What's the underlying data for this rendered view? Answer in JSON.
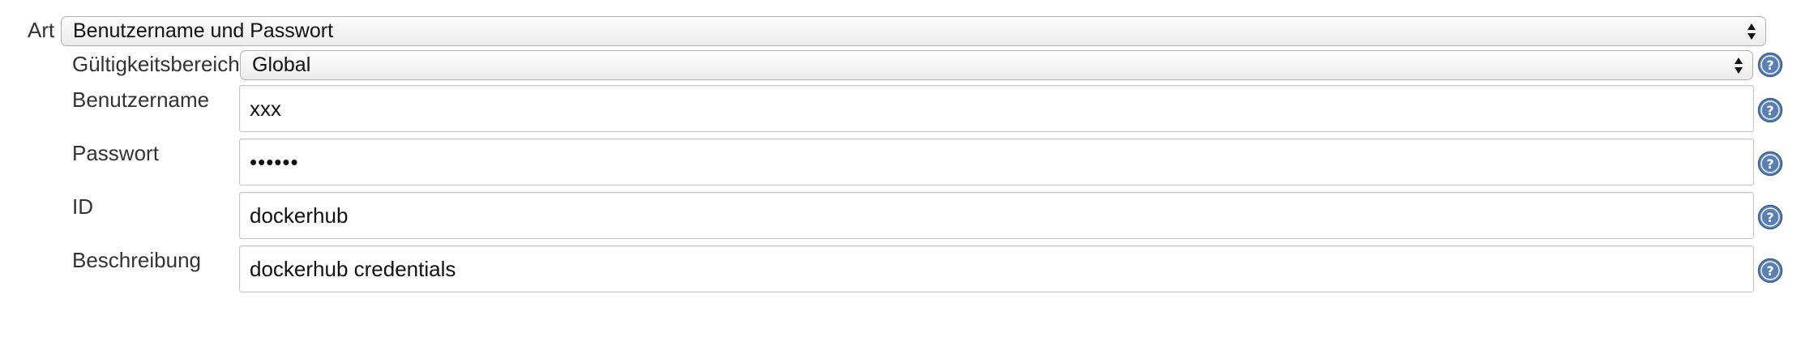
{
  "form": {
    "kind": {
      "label": "Art",
      "value": "Benutzername und Passwort"
    },
    "scope": {
      "label": "Gültigkeitsbereich",
      "value": "Global"
    },
    "username": {
      "label": "Benutzername",
      "value": "xxx"
    },
    "password": {
      "label": "Passwort",
      "value": "••••••"
    },
    "id": {
      "label": "ID",
      "value": "dockerhub"
    },
    "description": {
      "label": "Beschreibung",
      "value": "dockerhub credentials"
    }
  },
  "icons": {
    "help": "help-icon",
    "select_arrows": "updown-arrows-icon"
  },
  "colors": {
    "help_icon": "#5a7fb5",
    "border": "#c4c4c4"
  }
}
